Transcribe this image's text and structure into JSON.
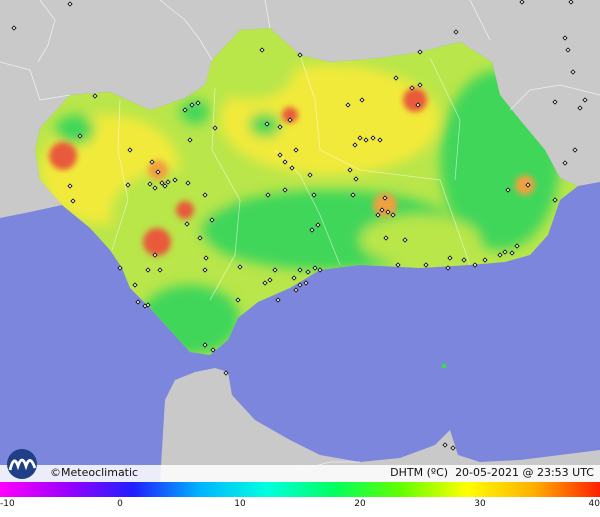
{
  "brand": {
    "name": "©Meteoclimatic"
  },
  "info": {
    "variable": "DHTM (ºC)",
    "datetime": "20-05-2021 @ 23:53 UTC"
  },
  "scale": {
    "ticks": [
      "-10",
      "0",
      "10",
      "20",
      "30",
      "40"
    ],
    "tick_values": [
      -10,
      0,
      10,
      20,
      30,
      40
    ],
    "min": -10,
    "max": 40,
    "colors": [
      "#ff00ff",
      "#9b00ff",
      "#1f1fff",
      "#00b4ff",
      "#00ffe0",
      "#00ff60",
      "#60ff00",
      "#ffff00",
      "#ffb000",
      "#ff2000"
    ]
  },
  "colors": {
    "sea": "#7c86dc",
    "foreign_land": "#c9c9c9",
    "cool_zone": "#3fd65a",
    "mild_zone": "#b9e64a",
    "warm_zone": "#f2ea3a",
    "hot_spot": "#e85a3a",
    "station": "#111111"
  }
}
